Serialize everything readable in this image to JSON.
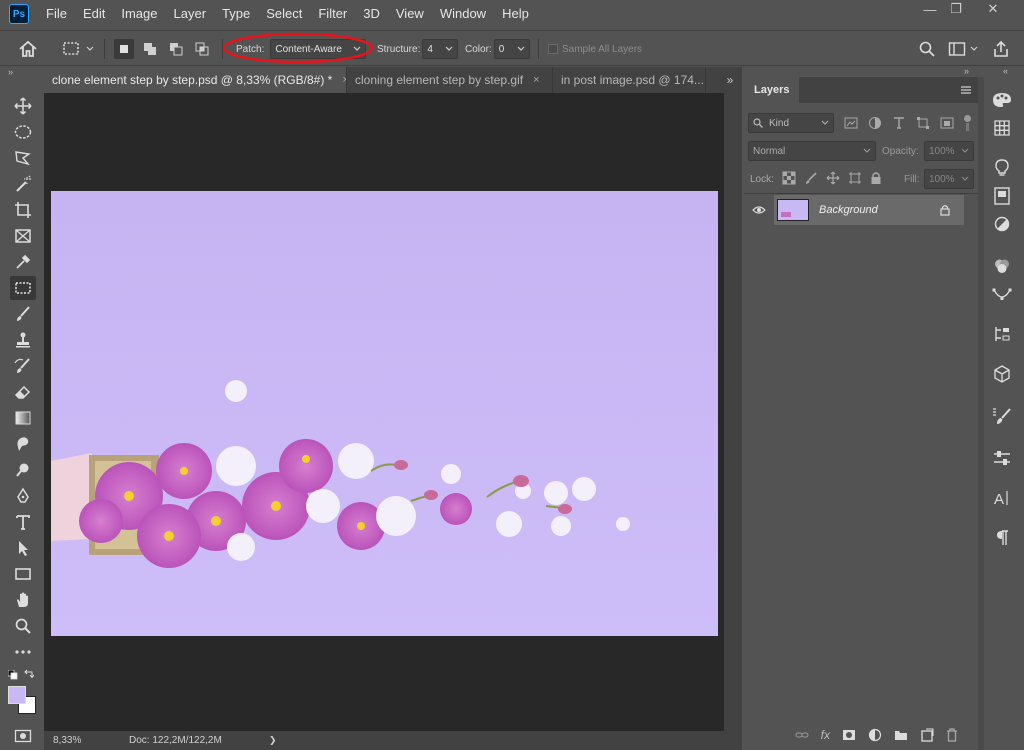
{
  "app": {
    "logo": "Ps"
  },
  "menu": [
    "File",
    "Edit",
    "Image",
    "Layer",
    "Type",
    "Select",
    "Filter",
    "3D",
    "View",
    "Window",
    "Help"
  ],
  "window_controls": {
    "minimize": "—",
    "restore": "❐",
    "close": "✕"
  },
  "options": {
    "patch_label": "Patch:",
    "patch_value": "Content-Aware",
    "structure_label": "Structure:",
    "structure_value": "4",
    "color_label": "Color:",
    "color_value": "0",
    "sample_all_layers": "Sample All Layers"
  },
  "tabs": [
    {
      "label": "clone element step by step.psd @ 8,33% (RGB/8#) *",
      "close": "×"
    },
    {
      "label": "cloning element step by step.gif",
      "close": "×"
    },
    {
      "label": "in post image.psd @ 174..."
    }
  ],
  "status": {
    "zoom": "8,33%",
    "doc": "Doc: 122,2M/122,2M",
    "arrow": "❯"
  },
  "layers_panel": {
    "title": "Layers",
    "filter_kind": "Kind",
    "blend_mode": "Normal",
    "opacity_label": "Opacity:",
    "opacity_value": "100%",
    "lock_label": "Lock:",
    "fill_label": "Fill:",
    "fill_value": "100%",
    "layers": [
      {
        "name": "Background"
      }
    ]
  },
  "colors": {
    "foreground": "#c9b8f5",
    "background": "#ffffff",
    "highlight_ellipse": "#e8141a"
  }
}
